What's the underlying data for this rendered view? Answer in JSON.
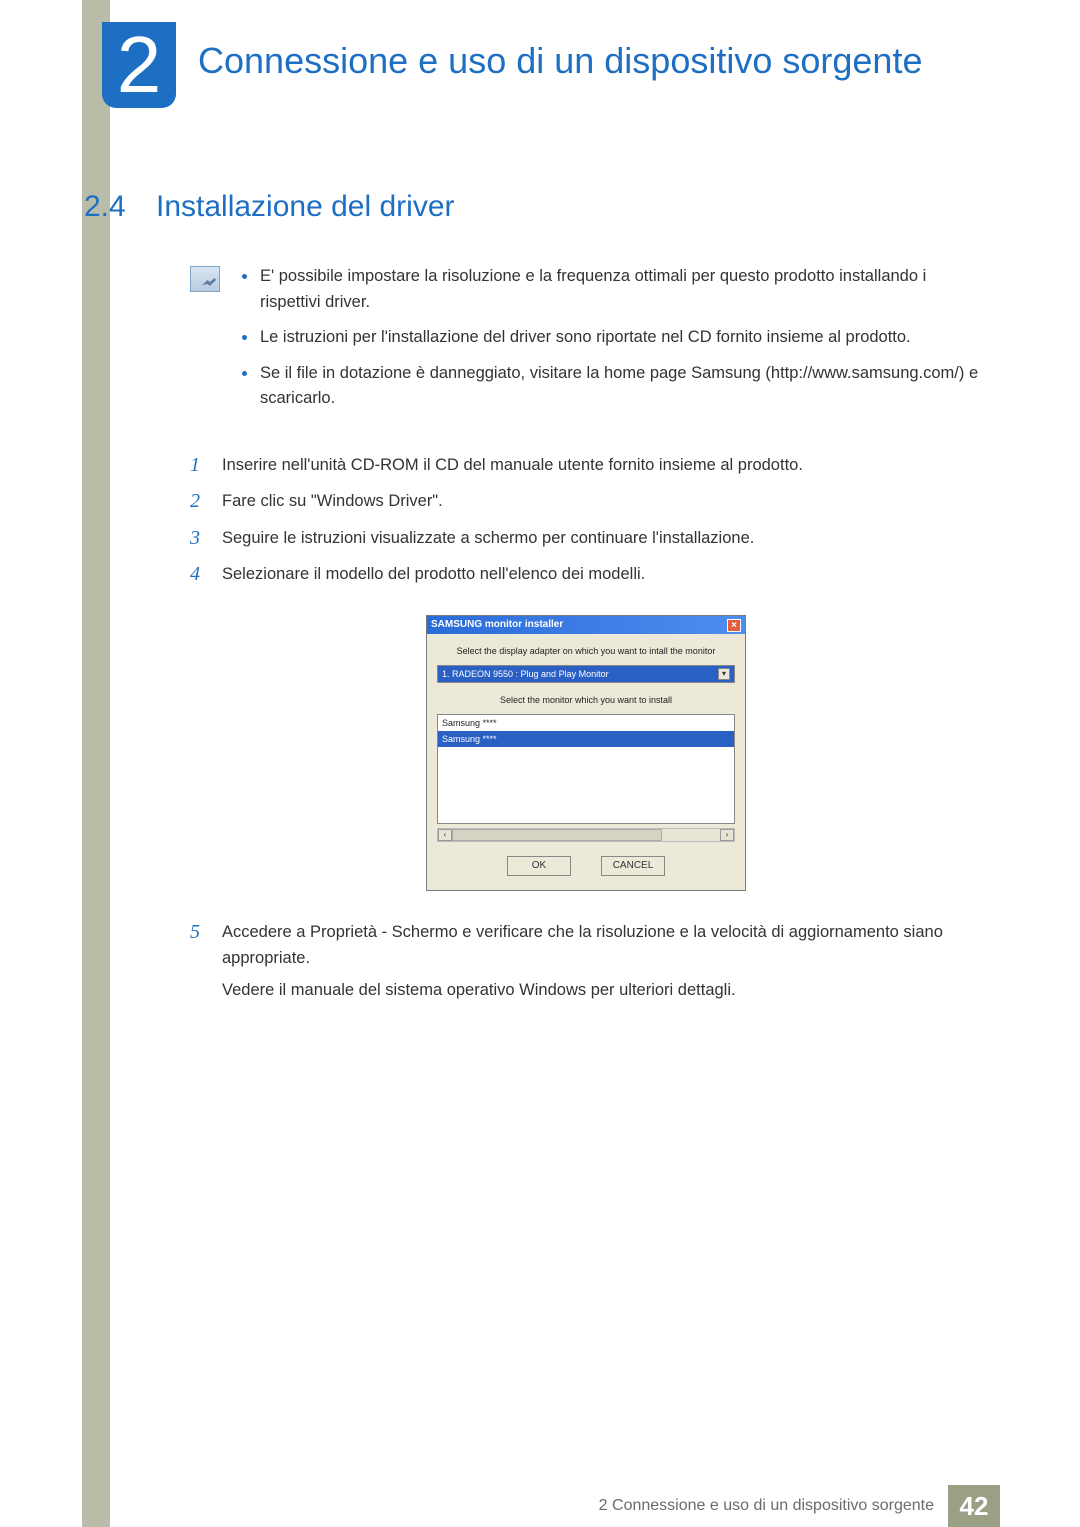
{
  "chapter": {
    "number": "2",
    "title": "Connessione e uso di un dispositivo sorgente"
  },
  "section": {
    "number": "2.4",
    "title": "Installazione del driver"
  },
  "notes": [
    "E' possibile impostare la risoluzione e la frequenza ottimali per questo prodotto installando i rispettivi driver.",
    "Le istruzioni per l'installazione del driver sono riportate nel CD fornito insieme al prodotto.",
    "Se il file in dotazione è danneggiato, visitare la home page Samsung (http://www.samsung.com/) e scaricarlo."
  ],
  "steps": [
    {
      "n": "1",
      "text": "Inserire nell'unità CD-ROM il CD del manuale utente fornito insieme al prodotto."
    },
    {
      "n": "2",
      "text": "Fare clic su \"Windows Driver\"."
    },
    {
      "n": "3",
      "text": "Seguire le istruzioni visualizzate a schermo per continuare l'installazione."
    },
    {
      "n": "4",
      "text": "Selezionare il modello del prodotto nell'elenco dei modelli."
    },
    {
      "n": "5",
      "text": "Accedere a Proprietà - Schermo e verificare che la risoluzione e la velocità di aggiornamento siano appropriate."
    }
  ],
  "step5_followup": "Vedere il manuale del sistema operativo Windows per ulteriori dettagli.",
  "dialog": {
    "title": "SAMSUNG monitor installer",
    "label_adapter": "Select the display adapter on which you want to intall the monitor",
    "adapter_value": "1. RADEON 9550 : Plug and Play Monitor",
    "label_monitor": "Select the monitor which you want to install",
    "options": [
      "Samsung ****",
      "Samsung ****"
    ],
    "ok": "OK",
    "cancel": "CANCEL"
  },
  "footer": {
    "text": "2 Connessione e uso di un dispositivo sorgente",
    "page": "42"
  }
}
